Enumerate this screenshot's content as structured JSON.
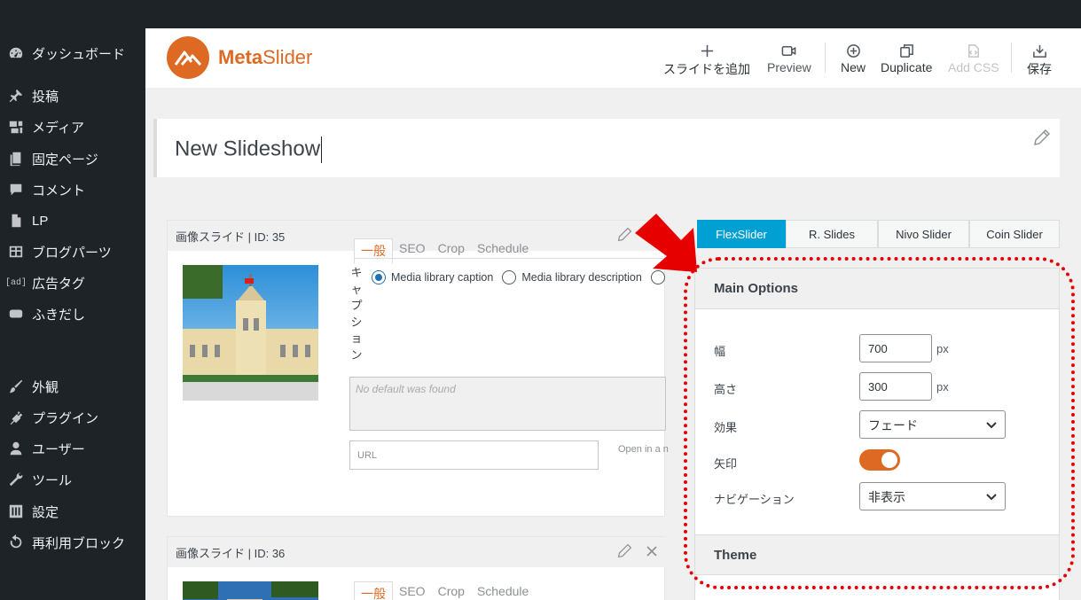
{
  "sidebar": {
    "items": [
      {
        "label": "ダッシュボード",
        "icon": "dashboard-icon"
      },
      {
        "label": "投稿",
        "icon": "pin-icon"
      },
      {
        "label": "メディア",
        "icon": "media-icon"
      },
      {
        "label": "固定ページ",
        "icon": "page-icon"
      },
      {
        "label": "コメント",
        "icon": "comment-icon"
      },
      {
        "label": "LP",
        "icon": "document-icon"
      },
      {
        "label": "ブログパーツ",
        "icon": "grid-icon"
      },
      {
        "label": "広告タグ",
        "icon": "ad-icon",
        "glyph": "[ad]"
      },
      {
        "label": "ふきだし",
        "icon": "speech-bubble-icon"
      },
      {
        "label": "外観",
        "icon": "paintbrush-icon"
      },
      {
        "label": "プラグイン",
        "icon": "plugin-icon"
      },
      {
        "label": "ユーザー",
        "icon": "user-icon"
      },
      {
        "label": "ツール",
        "icon": "wrench-icon"
      },
      {
        "label": "設定",
        "icon": "settings-icon"
      },
      {
        "label": "再利用ブロック",
        "icon": "reuse-icon"
      }
    ]
  },
  "header": {
    "logo": {
      "bold": "Meta",
      "rest": "Slider"
    },
    "toolbar": {
      "add_slide": "スライドを追加",
      "preview": "Preview",
      "new": "New",
      "duplicate": "Duplicate",
      "add_css": "Add CSS",
      "save": "保存"
    }
  },
  "slideshow": {
    "title": "New Slideshow"
  },
  "slides": [
    {
      "header": "画像スライド | ID: 35",
      "tabs": [
        "一般",
        "SEO",
        "Crop",
        "Schedule"
      ],
      "caption_label_vertical": [
        "キ",
        "ャ",
        "プ",
        "シ",
        "ョ",
        "ン"
      ],
      "caption_options": [
        "Media library caption",
        "Media library description"
      ],
      "caption_placeholder": "No default was found",
      "url_placeholder": "URL",
      "open_in": "Open in a n"
    },
    {
      "header": "画像スライド | ID: 36",
      "tabs": [
        "一般",
        "SEO",
        "Crop",
        "Schedule"
      ]
    }
  ],
  "slider_tabs": [
    "FlexSlider",
    "R. Slides",
    "Nivo Slider",
    "Coin Slider"
  ],
  "main_options": {
    "heading": "Main Options",
    "width_label": "幅",
    "width_value": "700",
    "width_unit": "px",
    "height_label": "高さ",
    "height_value": "300",
    "height_unit": "px",
    "effect_label": "効果",
    "effect_value": "フェード",
    "arrows_label": "矢印",
    "arrows_on": true,
    "navigation_label": "ナビゲーション",
    "navigation_value": "非表示"
  },
  "theme": {
    "heading": "Theme"
  },
  "colors": {
    "accent": "#dd6923",
    "tab_active": "#00a0d2",
    "annotation": "#e60000",
    "sidebar": "#1d2327"
  }
}
